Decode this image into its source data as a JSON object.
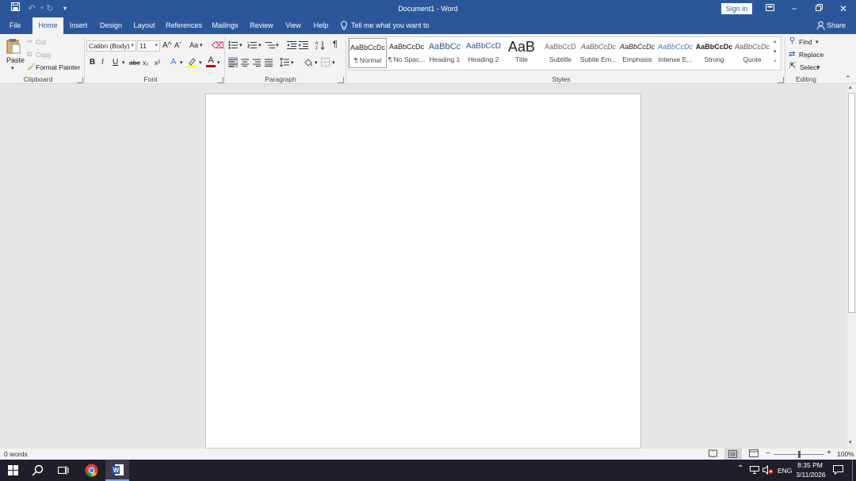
{
  "window": {
    "title": "Document1 - Word",
    "sign_in": "Sign in"
  },
  "tabs": [
    {
      "label": "File"
    },
    {
      "label": "Home"
    },
    {
      "label": "Insert"
    },
    {
      "label": "Design"
    },
    {
      "label": "Layout"
    },
    {
      "label": "References"
    },
    {
      "label": "Mailings"
    },
    {
      "label": "Review"
    },
    {
      "label": "View"
    },
    {
      "label": "Help"
    }
  ],
  "tell_me": "Tell me what you want to do",
  "share": "Share",
  "clipboard": {
    "paste": "Paste",
    "cut": "Cut",
    "copy": "Copy",
    "format_painter": "Format Painter",
    "label": "Clipboard"
  },
  "font": {
    "name": "Calibri (Body)",
    "size": "11",
    "label": "Font",
    "change_case": "Aa",
    "bold": "B",
    "italic": "I",
    "underline": "U",
    "strikethrough": "abc",
    "subscript": "x₂",
    "superscript": "x²",
    "grow": "A^",
    "shrink": "Aˇ",
    "font_color_letter": "A",
    "text_effects_letter": "A",
    "font_color": "#c00000",
    "highlight_color": "#ffff00"
  },
  "paragraph": {
    "label": "Paragraph"
  },
  "styles": {
    "label": "Styles",
    "items": [
      {
        "sample": "AaBbCcDc",
        "name": "¶ Normal"
      },
      {
        "sample": "AaBbCcDc",
        "name": "¶ No Spac..."
      },
      {
        "sample": "AaBbCc",
        "name": "Heading 1"
      },
      {
        "sample": "AaBbCcD",
        "name": "Heading 2"
      },
      {
        "sample": "AaB",
        "name": "Title"
      },
      {
        "sample": "AaBbCcD",
        "name": "Subtitle"
      },
      {
        "sample": "AaBbCcDc",
        "name": "Subtle Em..."
      },
      {
        "sample": "AaBbCcDc",
        "name": "Emphasis"
      },
      {
        "sample": "AaBbCcDc",
        "name": "Intense E..."
      },
      {
        "sample": "AaBbCcDc",
        "name": "Strong"
      },
      {
        "sample": "AaBbCcDc",
        "name": "Quote"
      }
    ]
  },
  "editing": {
    "find": "Find",
    "replace": "Replace",
    "select": "Select",
    "label": "Editing"
  },
  "status": {
    "word_count": "0 words",
    "zoom": "100%",
    "zoom_fraction": 0.5
  },
  "taskbar": {
    "time": "8:35 PM",
    "date": "3/11/2026",
    "lang": "ENG"
  },
  "colors": {
    "accent": "#2b579a"
  }
}
